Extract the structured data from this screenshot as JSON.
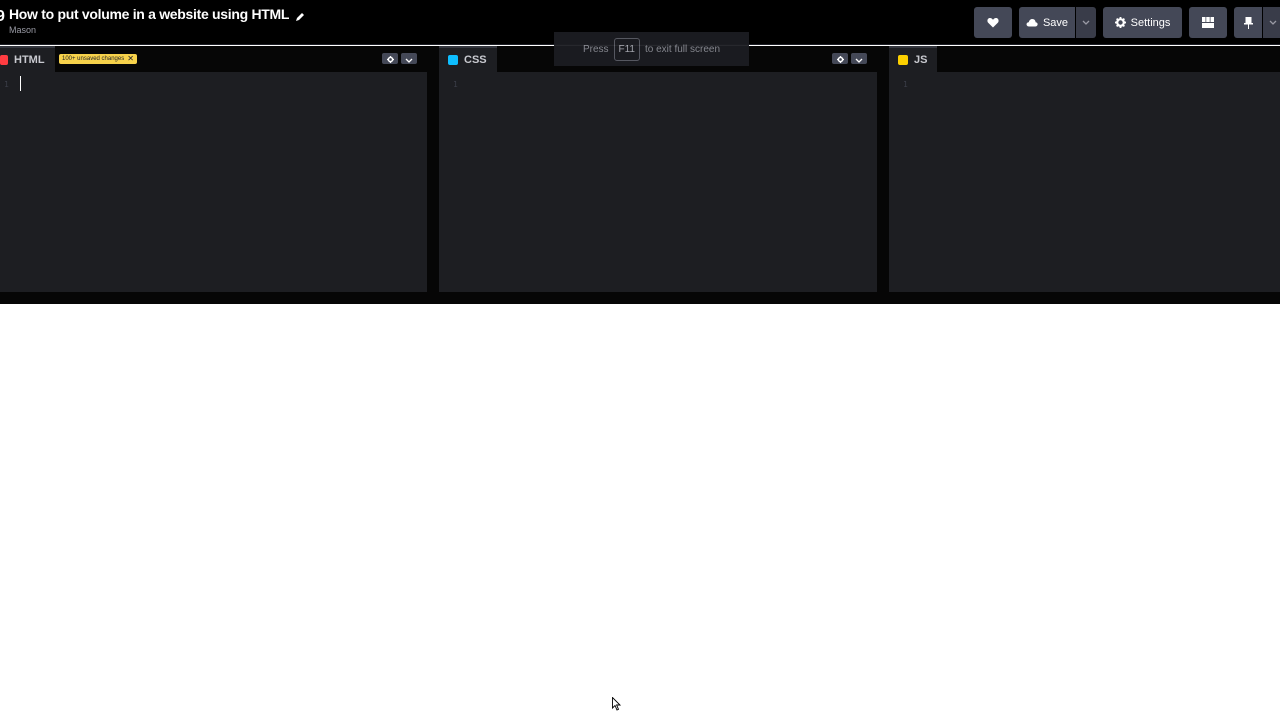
{
  "header": {
    "pen_title": "How to put volume in a website using HTML",
    "author": "Mason",
    "save_label": "Save",
    "settings_label": "Settings"
  },
  "fullscreen_notice": {
    "press": "Press",
    "key": "F11",
    "suffix": "to exit full screen"
  },
  "editors": {
    "html": {
      "label": "HTML",
      "badge": "100+ unsaved changes",
      "line": "1",
      "icon_color": "#ff3c41"
    },
    "css": {
      "label": "CSS",
      "line": "1",
      "icon_color": "#0ebeff"
    },
    "js": {
      "label": "JS",
      "line": "1",
      "icon_color": "#fcd000"
    }
  },
  "colors": {
    "accent_save": "#f7d24b",
    "button_bg": "#444857",
    "editor_bg": "#1d1e22"
  },
  "icons": {
    "heart": "heart-icon",
    "cloud": "cloud-icon",
    "gear": "gear-icon",
    "layout": "layout-icon",
    "pin": "pin-icon",
    "chevron": "chevron-down-icon"
  }
}
